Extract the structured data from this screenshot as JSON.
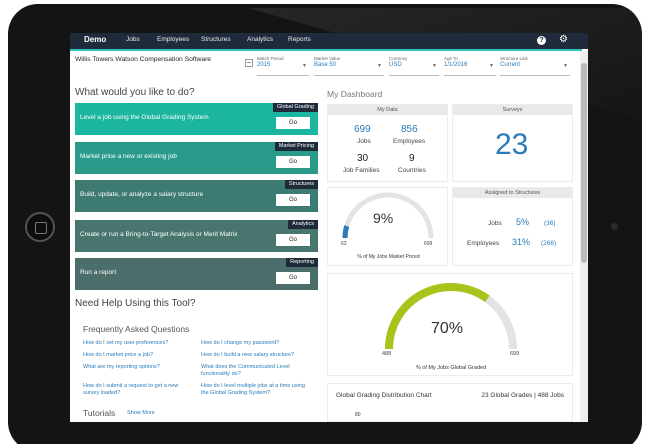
{
  "nav": {
    "brand": "Demo",
    "items": [
      "Jobs",
      "Employees",
      "Structures",
      "Analytics",
      "Reports"
    ],
    "help_label": "?"
  },
  "app_title": "Willis Towers Watson Compensation Software",
  "filters": [
    {
      "label": "Match Period",
      "value": "2015"
    },
    {
      "label": "Market Value",
      "value": "Base 50"
    },
    {
      "label": "Currency",
      "value": "USD"
    },
    {
      "label": "Age To",
      "value": "1/1/2016"
    },
    {
      "label": "Structure Link",
      "value": "Current"
    }
  ],
  "actions_title": "What would you like to do?",
  "actions": [
    {
      "label": "Level a job using the Global Grading System",
      "tag": "Global Grading",
      "button": "Go",
      "color": "#1bb5a0"
    },
    {
      "label": "Market price a new or existing job",
      "tag": "Market Pricing",
      "button": "Go",
      "color": "#2a9b8b"
    },
    {
      "label": "Build, update, or analyze a salary structure",
      "tag": "Structures",
      "button": "Go",
      "color": "#3c7a72"
    },
    {
      "label": "Create or run a Bring-to-Target Analysis or Merit Matrix",
      "tag": "Analytics",
      "button": "Go",
      "color": "#49756f"
    },
    {
      "label": "Run a report",
      "tag": "Reporting",
      "button": "Go",
      "color": "#4b6e6a"
    }
  ],
  "help_title": "Need Help Using this Tool?",
  "faq_title": "Frequently Asked Questions",
  "faq_left": [
    "How do I set my user preferences?",
    "How do I market price a job?",
    "What are my reporting options?",
    "How do I submit a request to get a new survey loaded?"
  ],
  "faq_right": [
    "How do I change my password?",
    "How do I build a new salary structure?",
    "What does the Communicated Level functionality do?",
    "How do I level multiple jobs at a time using the Global Grading System?"
  ],
  "tutorials_title": "Tutorials",
  "tutorials_more": "Show More",
  "dashboard": {
    "title": "My Dashboard",
    "my_data": {
      "header": "My Data",
      "jobs_value": "699",
      "jobs_label": "Jobs",
      "employees_value": "856",
      "employees_label": "Employees",
      "families_value": "30",
      "families_label": "Job Families",
      "countries_value": "9",
      "countries_label": "Countries"
    },
    "surveys": {
      "header": "Surveys",
      "value": "23"
    },
    "market_priced": {
      "percent_text": "9%",
      "min": "63",
      "max": "699",
      "caption": "% of My Jobs Market Priced",
      "fraction": 0.09
    },
    "assigned": {
      "header": "Assigned to Structures",
      "jobs_label": "Jobs",
      "jobs_pct": "5%",
      "jobs_count": "(36)",
      "emp_label": "Employees",
      "emp_pct": "31%",
      "emp_count": "(266)"
    },
    "graded": {
      "percent_text": "70%",
      "min": "488",
      "max": "699",
      "caption": "% of My Jobs Global Graded",
      "fraction": 0.7
    },
    "distribution": {
      "title": "Global Grading Distribution Chart",
      "summary": "23 Global Grades | 488 Jobs",
      "axis_tick": "80"
    }
  },
  "colors": {
    "nav_bg": "#1f2b3a",
    "accent_teal": "#2cc5b9",
    "link_blue": "#2b7bb9",
    "gauge_green": "#a8c41a",
    "gauge_blue": "#2b7bb9"
  }
}
